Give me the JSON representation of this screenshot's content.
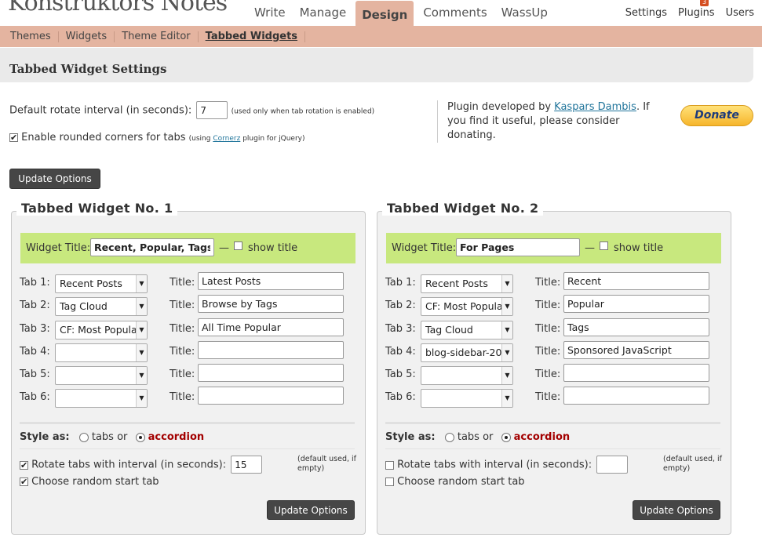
{
  "header": {
    "site_title": "Konstruktors Notes",
    "main_nav": [
      "Write",
      "Manage",
      "Design",
      "Comments",
      "WassUp"
    ],
    "active_nav": "Design",
    "user_nav": [
      "Settings",
      "Plugins",
      "Users"
    ],
    "plugins_badge": "3"
  },
  "subnav": [
    "Themes",
    "Widgets",
    "Theme Editor",
    "Tabbed Widgets"
  ],
  "page": {
    "title": "Tabbed Widget Settings"
  },
  "general": {
    "rotate_label": "Default rotate interval (in seconds):",
    "rotate_value": "7",
    "rotate_note": "(used only when tab rotation is enabled)",
    "rounded_checked": true,
    "rounded_label": "Enable rounded corners for tabs",
    "rounded_note_pre": "(using",
    "rounded_note_link": "Cornerz",
    "rounded_note_post": "plugin for jQuery)",
    "update_button": "Update Options"
  },
  "plugin_info": {
    "text_pre": "Plugin developed by",
    "author": "Kaspars Dambis",
    "text_post": ". If you find it useful, please consider donating.",
    "donate": "Donate"
  },
  "widgets": [
    {
      "heading": "Tabbed Widget No. 1",
      "widget_title_label": "Widget Title:",
      "widget_title": "Recent, Popular, Tags +",
      "dash": "—",
      "show_title_label": "show title",
      "show_title_checked": false,
      "tabs": [
        {
          "label": "Tab 1:",
          "select": "Recent Posts",
          "title_label": "Title:",
          "title": "Latest Posts"
        },
        {
          "label": "Tab 2:",
          "select": "Tag Cloud",
          "title_label": "Title:",
          "title": "Browse by Tags"
        },
        {
          "label": "Tab 3:",
          "select": "CF: Most Popular",
          "title_label": "Title:",
          "title": "All Time Popular"
        },
        {
          "label": "Tab 4:",
          "select": "",
          "title_label": "Title:",
          "title": ""
        },
        {
          "label": "Tab 5:",
          "select": "",
          "title_label": "Title:",
          "title": ""
        },
        {
          "label": "Tab 6:",
          "select": "",
          "title_label": "Title:",
          "title": ""
        }
      ],
      "style_label": "Style as:",
      "style_tabs": "tabs or",
      "style_accordion": "accordion",
      "style_selected": "accordion",
      "rotate_checked": true,
      "rotate_label": "Rotate tabs with interval (in seconds):",
      "rotate_value": "15",
      "default_note": "(default used, if empty)",
      "random_checked": true,
      "random_label": "Choose random start tab",
      "update_button": "Update Options"
    },
    {
      "heading": "Tabbed Widget No. 2",
      "widget_title_label": "Widget Title:",
      "widget_title": "For Pages",
      "dash": "—",
      "show_title_label": "show title",
      "show_title_checked": false,
      "tabs": [
        {
          "label": "Tab 1:",
          "select": "Recent Posts",
          "title_label": "Title:",
          "title": "Recent"
        },
        {
          "label": "Tab 2:",
          "select": "CF: Most Popular",
          "title_label": "Title:",
          "title": "Popular"
        },
        {
          "label": "Tab 3:",
          "select": "Tag Cloud",
          "title_label": "Title:",
          "title": "Tags"
        },
        {
          "label": "Tab 4:",
          "select": "blog-sidebar-20",
          "title_label": "Title:",
          "title": "Sponsored JavaScript"
        },
        {
          "label": "Tab 5:",
          "select": "",
          "title_label": "Title:",
          "title": ""
        },
        {
          "label": "Tab 6:",
          "select": "",
          "title_label": "Title:",
          "title": ""
        }
      ],
      "style_label": "Style as:",
      "style_tabs": "tabs or",
      "style_accordion": "accordion",
      "style_selected": "accordion",
      "rotate_checked": false,
      "rotate_label": "Rotate tabs with interval (in seconds):",
      "rotate_value": "",
      "default_note": "(default used, if empty)",
      "random_checked": false,
      "random_label": "Choose random start tab",
      "update_button": "Update Options"
    }
  ]
}
